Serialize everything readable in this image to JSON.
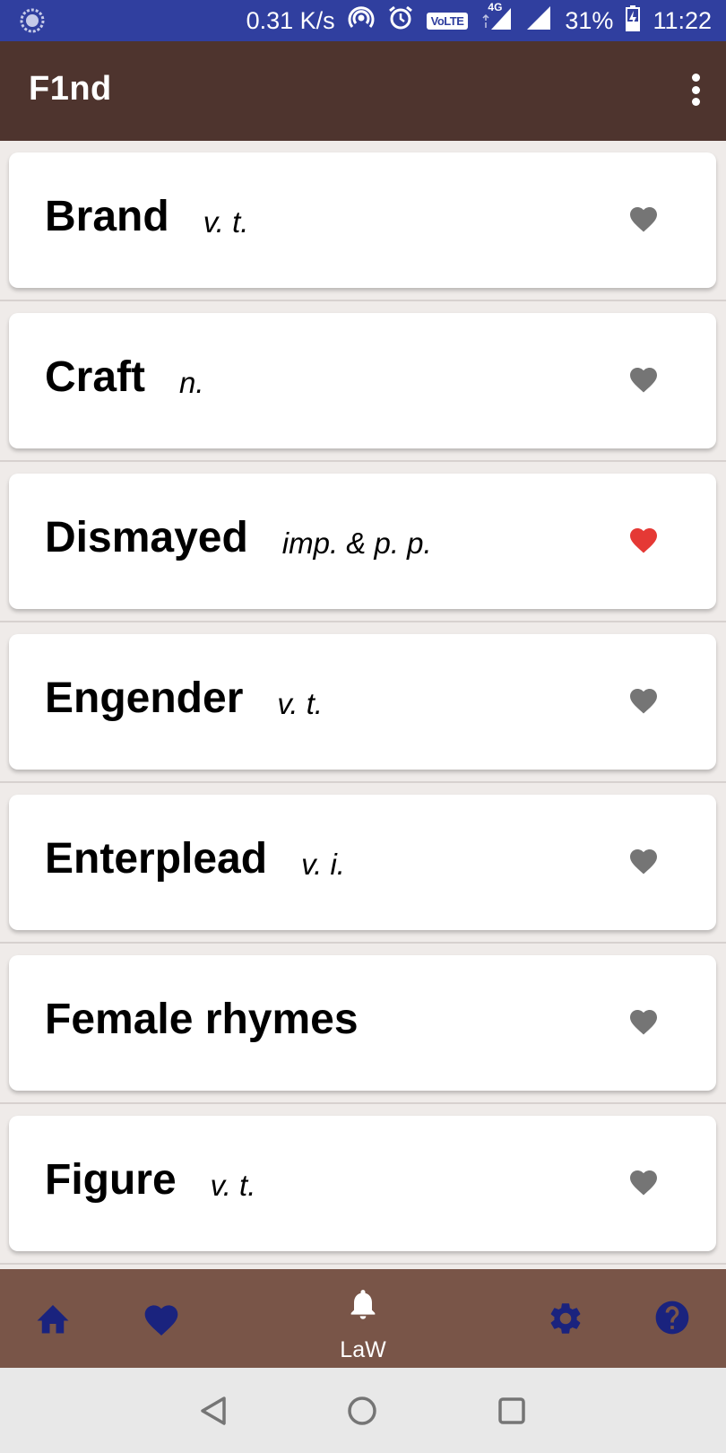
{
  "status_bar": {
    "net_speed": "0.31 K/s",
    "volte": "VoLTE",
    "network": "4G",
    "battery": "31%",
    "time": "11:22"
  },
  "app_bar": {
    "title": "F1nd"
  },
  "words": [
    {
      "word": "Brand",
      "pos": "v. t.",
      "favorite": false
    },
    {
      "word": "Craft",
      "pos": "n.",
      "favorite": false
    },
    {
      "word": "Dismayed",
      "pos": "imp. & p. p.",
      "favorite": true
    },
    {
      "word": "Engender",
      "pos": "v. t.",
      "favorite": false
    },
    {
      "word": "Enterplead",
      "pos": "v. i.",
      "favorite": false
    },
    {
      "word": "Female rhymes",
      "pos": "",
      "favorite": false
    },
    {
      "word": "Figure",
      "pos": "v. t.",
      "favorite": false
    }
  ],
  "bottom_nav": {
    "items": [
      {
        "icon": "home-icon"
      },
      {
        "icon": "heart-icon"
      },
      {
        "icon": "bell-icon",
        "label": "LaW",
        "active": true
      },
      {
        "icon": "gear-icon"
      },
      {
        "icon": "help-icon"
      }
    ]
  },
  "colors": {
    "status_bar": "#303f9f",
    "app_bar": "#4e342e",
    "bottom_nav": "#795548",
    "nav_icon": "#1a237e",
    "favorite_on": "#e53935",
    "favorite_off": "#757575"
  }
}
